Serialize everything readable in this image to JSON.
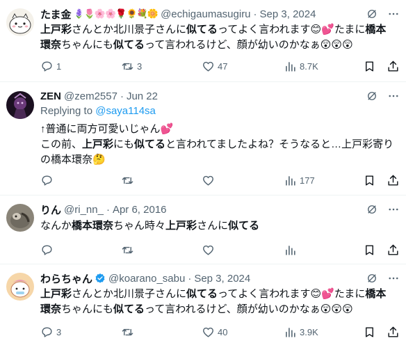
{
  "tweets": [
    {
      "name": "たま金",
      "name_emojis": "🪻🌷🌸🌸🌹🌻💐🌼",
      "handle": "@echigaumasugiru",
      "date": "Sep 3, 2024",
      "text_line1": [
        {
          "t": "上戸彩",
          "b": true
        },
        {
          "t": "さんとか北川景子さんに",
          "b": false
        },
        {
          "t": "似てる",
          "b": true
        },
        {
          "t": "ってよく言われます😊💕たまに",
          "b": false
        },
        {
          "t": "橋本",
          "b": true
        }
      ],
      "text_line2": [
        {
          "t": "環奈",
          "b": true
        },
        {
          "t": "ちゃんにも",
          "b": false
        },
        {
          "t": "似てる",
          "b": true
        },
        {
          "t": "って言われるけど、顔が幼いのかなぁ😲😲😲",
          "b": false
        }
      ],
      "replies": "1",
      "reposts": "3",
      "likes": "47",
      "views": "8.7K"
    },
    {
      "name": "ZEN",
      "handle": "@zem2557",
      "date": "Jun 22",
      "replying_label": "Replying to",
      "replying_handle": "@saya114sa",
      "text_line1": [
        {
          "t": "↑普通に両方可愛いじゃん💕",
          "b": false
        }
      ],
      "text_line2": [
        {
          "t": "この前、",
          "b": false
        },
        {
          "t": "上戸彩",
          "b": true
        },
        {
          "t": "にも",
          "b": false
        },
        {
          "t": "似てる",
          "b": true
        },
        {
          "t": "と言われてましたよね？そうなると…上戸彩寄り",
          "b": false
        }
      ],
      "text_line3": [
        {
          "t": "の橋本環奈🤔",
          "b": false
        }
      ],
      "replies": "",
      "reposts": "",
      "likes": "",
      "views": "177"
    },
    {
      "name": "りん",
      "handle": "@ri_nn_",
      "date": "Apr 6, 2016",
      "text_line1": [
        {
          "t": "なんか",
          "b": false
        },
        {
          "t": "橋本環奈",
          "b": true
        },
        {
          "t": "ちゃん時々",
          "b": false
        },
        {
          "t": "上戸彩",
          "b": true
        },
        {
          "t": "さんに",
          "b": false
        },
        {
          "t": "似てる",
          "b": true
        }
      ],
      "replies": "",
      "reposts": "",
      "likes": "",
      "views": ""
    },
    {
      "name": "わらちゃん",
      "handle": "@koarano_sabu",
      "date": "Sep 3, 2024",
      "verified": true,
      "text_line1": [
        {
          "t": "上戸彩",
          "b": true
        },
        {
          "t": "さんとか北川景子さんに",
          "b": false
        },
        {
          "t": "似てる",
          "b": true
        },
        {
          "t": "ってよく言われます😊💕たまに",
          "b": false
        },
        {
          "t": "橋本",
          "b": true
        }
      ],
      "text_line2": [
        {
          "t": "環奈",
          "b": true
        },
        {
          "t": "ちゃんにも",
          "b": false
        },
        {
          "t": "似てる",
          "b": true
        },
        {
          "t": "って言われるけど、顔が幼いのかなぁ😲😲😲",
          "b": false
        }
      ],
      "replies": "3",
      "reposts": "",
      "likes": "40",
      "views": "3.9K"
    }
  ],
  "colors": {
    "text": "#0f1419",
    "secondary": "#536471",
    "link": "#1d9bf0",
    "verified": "#1d9bf0",
    "divider": "#eff3f4"
  },
  "icons": [
    "reply-icon",
    "repost-icon",
    "like-icon",
    "views-icon",
    "bookmark-icon",
    "share-icon",
    "grok-icon",
    "more-icon",
    "verified-badge-icon"
  ]
}
